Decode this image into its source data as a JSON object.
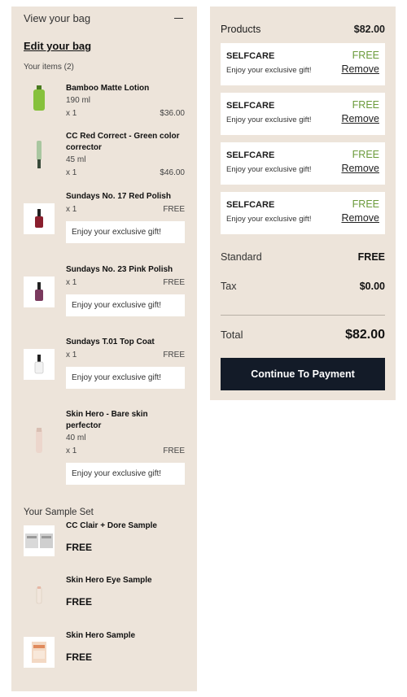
{
  "bag": {
    "header": "View your bag",
    "edit_label": "Edit your bag",
    "items_count": "Your items (2)",
    "gift_text": "Enjoy your exclusive gift!",
    "items": [
      {
        "name": "Bamboo Matte Lotion",
        "size": "190 ml",
        "qty": "x 1",
        "price": "$36.00"
      },
      {
        "name": "CC Red Correct - Green color corrector",
        "size": "45 ml",
        "qty": "x 1",
        "price": "$46.00"
      },
      {
        "name": "Sundays No. 17 Red Polish",
        "qty": "x 1",
        "price": "FREE"
      },
      {
        "name": "Sundays No. 23 Pink Polish",
        "qty": "x 1",
        "price": "FREE"
      },
      {
        "name": "Sundays T.01 Top Coat",
        "qty": "x 1",
        "price": "FREE"
      },
      {
        "name": "Skin Hero - Bare skin perfector",
        "size": "40 ml",
        "qty": "x 1",
        "price": "FREE"
      }
    ],
    "sample_title": "Your Sample Set",
    "samples": [
      {
        "name": "CC Clair + Dore Sample",
        "price": "FREE"
      },
      {
        "name": "Skin Hero Eye Sample",
        "price": "FREE"
      },
      {
        "name": "Skin Hero Sample",
        "price": "FREE"
      }
    ]
  },
  "summary": {
    "products_label": "Products",
    "products_amount": "$82.00",
    "gifts": [
      {
        "code": "SELFCARE",
        "status": "FREE",
        "message": "Enjoy your exclusive gift!",
        "remove": "Remove"
      },
      {
        "code": "SELFCARE",
        "status": "FREE",
        "message": "Enjoy your exclusive gift!",
        "remove": "Remove"
      },
      {
        "code": "SELFCARE",
        "status": "FREE",
        "message": "Enjoy your exclusive gift!",
        "remove": "Remove"
      },
      {
        "code": "SELFCARE",
        "status": "FREE",
        "message": "Enjoy your exclusive gift!",
        "remove": "Remove"
      }
    ],
    "shipping_label": "Standard",
    "shipping_value": "FREE",
    "tax_label": "Tax",
    "tax_value": "$0.00",
    "total_label": "Total",
    "total_value": "$82.00",
    "pay_button": "Continue To Payment"
  },
  "colors": {
    "panel_bg": "#ede4da",
    "button_bg": "#131b28",
    "free_green": "#6a9a3a"
  }
}
